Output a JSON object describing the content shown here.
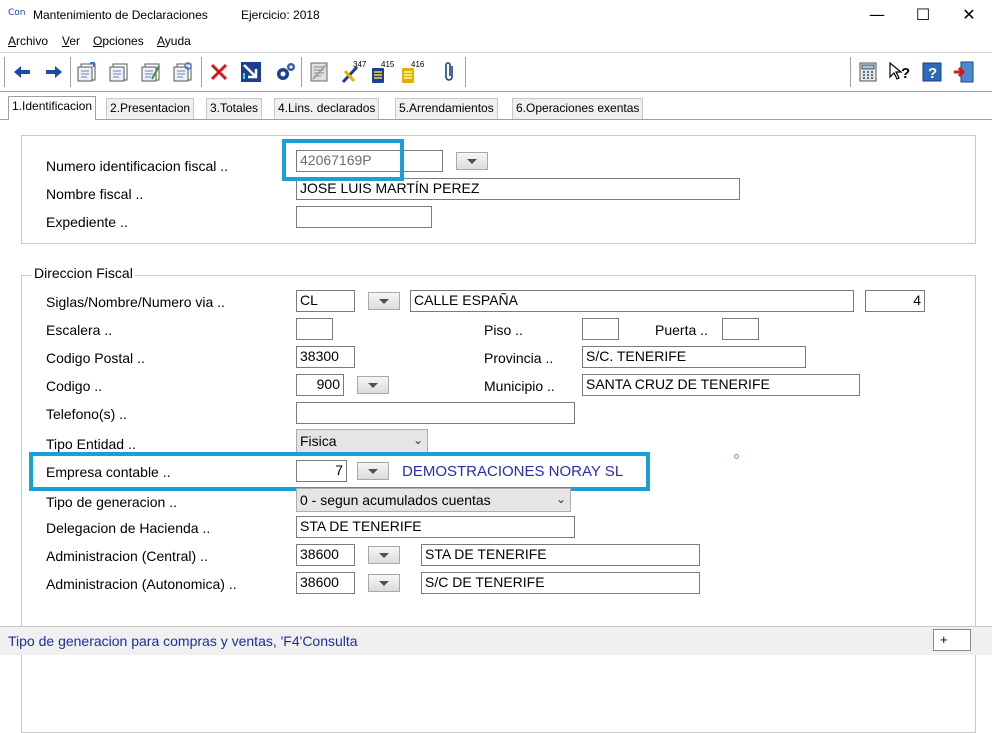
{
  "window": {
    "icon_text": "Con",
    "title": "Mantenimiento de Declaraciones",
    "ejercicio": "Ejercicio: 2018",
    "minimize": "—",
    "maximize": "☐",
    "close": "✕"
  },
  "menu": [
    {
      "key": "A",
      "rest": "rchivo"
    },
    {
      "key": "V",
      "rest": "er"
    },
    {
      "key": "O",
      "rest": "pciones"
    },
    {
      "key": "A",
      "rest": "yuda"
    }
  ],
  "toolbar": {
    "icons": [
      "back-arrow-icon",
      "forward-arrow-icon",
      "new-record-icon",
      "copy-record-icon",
      "edit-record-icon",
      "print-record-icon",
      "delete-icon",
      "select-icon",
      "settings-icon",
      "document-icon",
      "model-347-icon",
      "model-415-icon",
      "model-416-icon",
      "attach-icon",
      "calculator-icon",
      "help-pointer-icon",
      "help-book-icon",
      "exit-icon"
    ],
    "badges": {
      "m347": "347",
      "m415": "415",
      "m416": "416"
    }
  },
  "tabs": [
    "1.Identificacion",
    "2.Presentacion",
    "3.Totales",
    "4.Lins. declarados",
    "5.Arrendamientos",
    "6.Operaciones exentas"
  ],
  "identificacion": {
    "nif_label": "Numero identificacion fiscal ..",
    "nif_value": "42067169P",
    "nombre_label": "Nombre fiscal ..",
    "nombre_value": "JOSE LUIS MARTÍN  PEREZ",
    "expediente_label": "Expediente ..",
    "expediente_value": ""
  },
  "direccion": {
    "group_title": "Direccion Fiscal",
    "via_label": "Siglas/Nombre/Numero via ..",
    "siglas": "CL",
    "calle": "CALLE ESPAÑA",
    "numero": "4",
    "escalera_label": "Escalera ..",
    "escalera": "",
    "piso_label": "Piso ..",
    "piso": "",
    "puerta_label": "Puerta ..",
    "puerta": "",
    "cp_label": "Codigo Postal ..",
    "cp": "38300",
    "provincia_label": "Provincia ..",
    "provincia": "S/C. TENERIFE",
    "codigo_label": "Codigo ..",
    "codigo": "900",
    "municipio_label": "Municipio ..",
    "municipio": "SANTA CRUZ DE TENERIFE",
    "telefono_label": "Telefono(s) ..",
    "telefono": "",
    "tipo_entidad_label": "Tipo Entidad ..",
    "tipo_entidad": "Fisica",
    "empresa_label": "Empresa contable ..",
    "empresa_codigo": "7",
    "empresa_nombre": "DEMOSTRACIONES NORAY SL",
    "tipo_gen_label": "Tipo de generacion ..",
    "tipo_gen": "0 - segun acumulados cuentas",
    "delegacion_label": "Delegacion de Hacienda ..",
    "delegacion": "STA DE TENERIFE",
    "adm_central_label": "Administracion (Central) ..",
    "adm_central_codigo": "38600",
    "adm_central_nombre": "STA DE TENERIFE",
    "adm_auto_label": "Administracion (Autonomica) ..",
    "adm_auto_codigo": "38600",
    "adm_auto_nombre": "S/C DE TENERIFE"
  },
  "status": {
    "text": "Tipo de generacion para compras y ventas, 'F4'Consulta",
    "indicator": "+"
  },
  "colors": {
    "highlight": "#1aa0d8",
    "status_text": "#1a2f9e",
    "empresa_text": "#2a2ab0"
  }
}
